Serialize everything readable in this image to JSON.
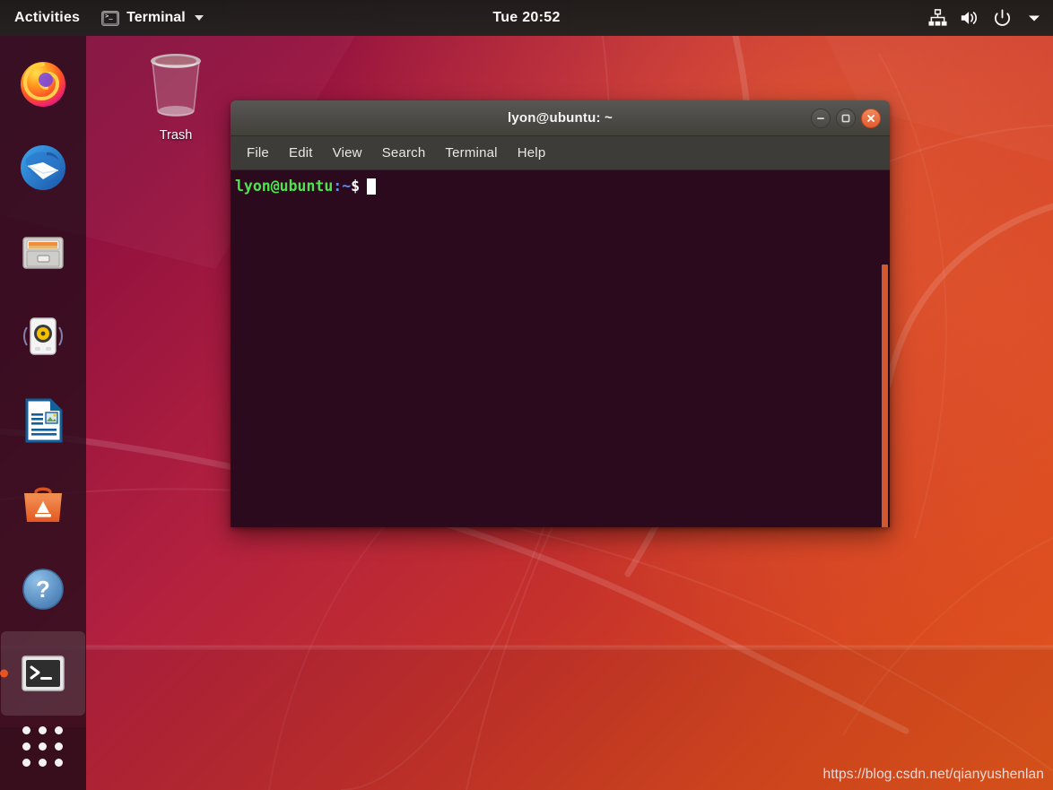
{
  "topbar": {
    "activities_label": "Activities",
    "app_name": "Terminal",
    "app_icon": "terminal-icon",
    "clock": "Tue 20:52",
    "tray": [
      {
        "name": "network-icon",
        "label": "network"
      },
      {
        "name": "volume-icon",
        "label": "volume"
      },
      {
        "name": "power-icon",
        "label": "power"
      },
      {
        "name": "chevron-down-icon",
        "label": "system menu"
      }
    ]
  },
  "dock": {
    "items": [
      {
        "name": "firefox",
        "label": "Firefox Web Browser",
        "active": false
      },
      {
        "name": "thunderbird",
        "label": "Thunderbird Mail",
        "active": false
      },
      {
        "name": "files",
        "label": "Files",
        "active": false
      },
      {
        "name": "rhythmbox",
        "label": "Rhythmbox",
        "active": false
      },
      {
        "name": "libreoffice-writer",
        "label": "LibreOffice Writer",
        "active": false
      },
      {
        "name": "ubuntu-software",
        "label": "Ubuntu Software",
        "active": false
      },
      {
        "name": "help",
        "label": "Help",
        "active": false
      },
      {
        "name": "terminal",
        "label": "Terminal",
        "active": true
      }
    ],
    "show_applications_label": "Show Applications"
  },
  "desktop": {
    "icons": [
      {
        "name": "trash",
        "label": "Trash"
      }
    ]
  },
  "terminal": {
    "title": "lyon@ubuntu: ~",
    "menu": [
      "File",
      "Edit",
      "View",
      "Search",
      "Terminal",
      "Help"
    ],
    "window_buttons": [
      {
        "name": "minimize-button",
        "glyph": "minimize"
      },
      {
        "name": "maximize-button",
        "glyph": "maximize"
      },
      {
        "name": "close-button",
        "glyph": "close"
      }
    ],
    "prompt": {
      "user_host": "lyon@ubuntu",
      "separator": ":",
      "path": "~",
      "symbol": "$"
    },
    "colors": {
      "background": "#2c0a1d",
      "titlebar": "#4b4a46",
      "menubar": "#3d3c38",
      "prompt_user": "#4ee44e",
      "prompt_path": "#5c8bf5",
      "scrollbar": "#d1582e",
      "close_button": "#e25b30"
    }
  },
  "watermark": {
    "text": "https://blog.csdn.net/qianyushenlan"
  },
  "theme": {
    "accent": "#e95420",
    "topbar_bg": "#232220",
    "dock_bg": "rgba(38,12,28,0.80)"
  }
}
